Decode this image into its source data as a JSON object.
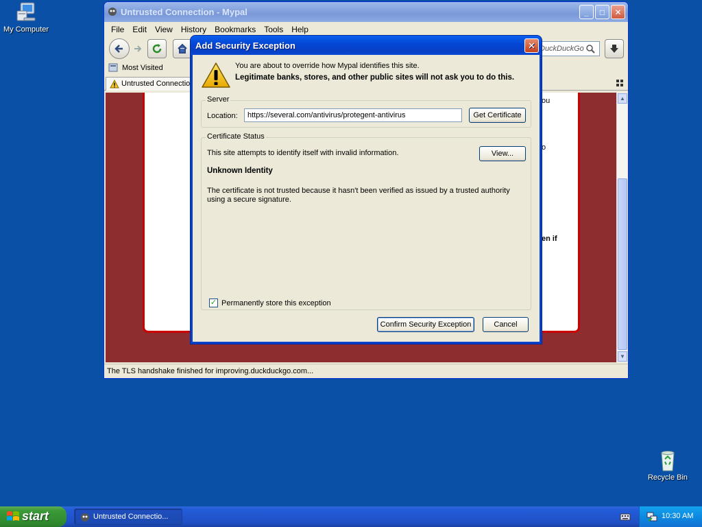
{
  "desktop": {
    "icons": [
      {
        "label": "My Computer",
        "icon": "my-computer-icon"
      },
      {
        "label": "Recycle Bin",
        "icon": "recycle-bin-icon"
      }
    ]
  },
  "browser": {
    "title": "Untrusted Connection - Mypal",
    "menu": [
      "File",
      "Edit",
      "View",
      "History",
      "Bookmarks",
      "Tools",
      "Help"
    ],
    "search_placeholder": "DuckDuckGo",
    "bookmark_label": "Most Visited",
    "tab_label": "Untrusted Connection",
    "status_text": "The TLS handshake finished for improving.duckduckgo.com...",
    "background_fragments": [
      "ou",
      "o",
      "en if"
    ]
  },
  "dialog": {
    "title": "Add Security Exception",
    "intro_line1": "You are about to override how Mypal identifies this site.",
    "intro_line2": "Legitimate banks, stores, and other public sites will not ask you to do this.",
    "server": {
      "legend": "Server",
      "location_label": "Location:",
      "location_value": "https://several.com/antivirus/protegent-antivirus",
      "get_certificate_label": "Get Certificate"
    },
    "status": {
      "legend": "Certificate Status",
      "summary": "This site attempts to identify itself with invalid information.",
      "view_label": "View...",
      "heading": "Unknown Identity",
      "description": "The certificate is not trusted because it hasn't been verified as issued by a trusted authority using a secure signature."
    },
    "permanent_label": "Permanently store this exception",
    "permanent_checked": true,
    "confirm_label": "Confirm Security Exception",
    "cancel_label": "Cancel"
  },
  "taskbar": {
    "start_label": "start",
    "task_label": "Untrusted Connectio...",
    "clock": "10:30 AM"
  },
  "colors": {
    "desktop": "#0a50a6",
    "dialog_title": "#0445d4",
    "error_page_bg": "#8e2d2f"
  }
}
